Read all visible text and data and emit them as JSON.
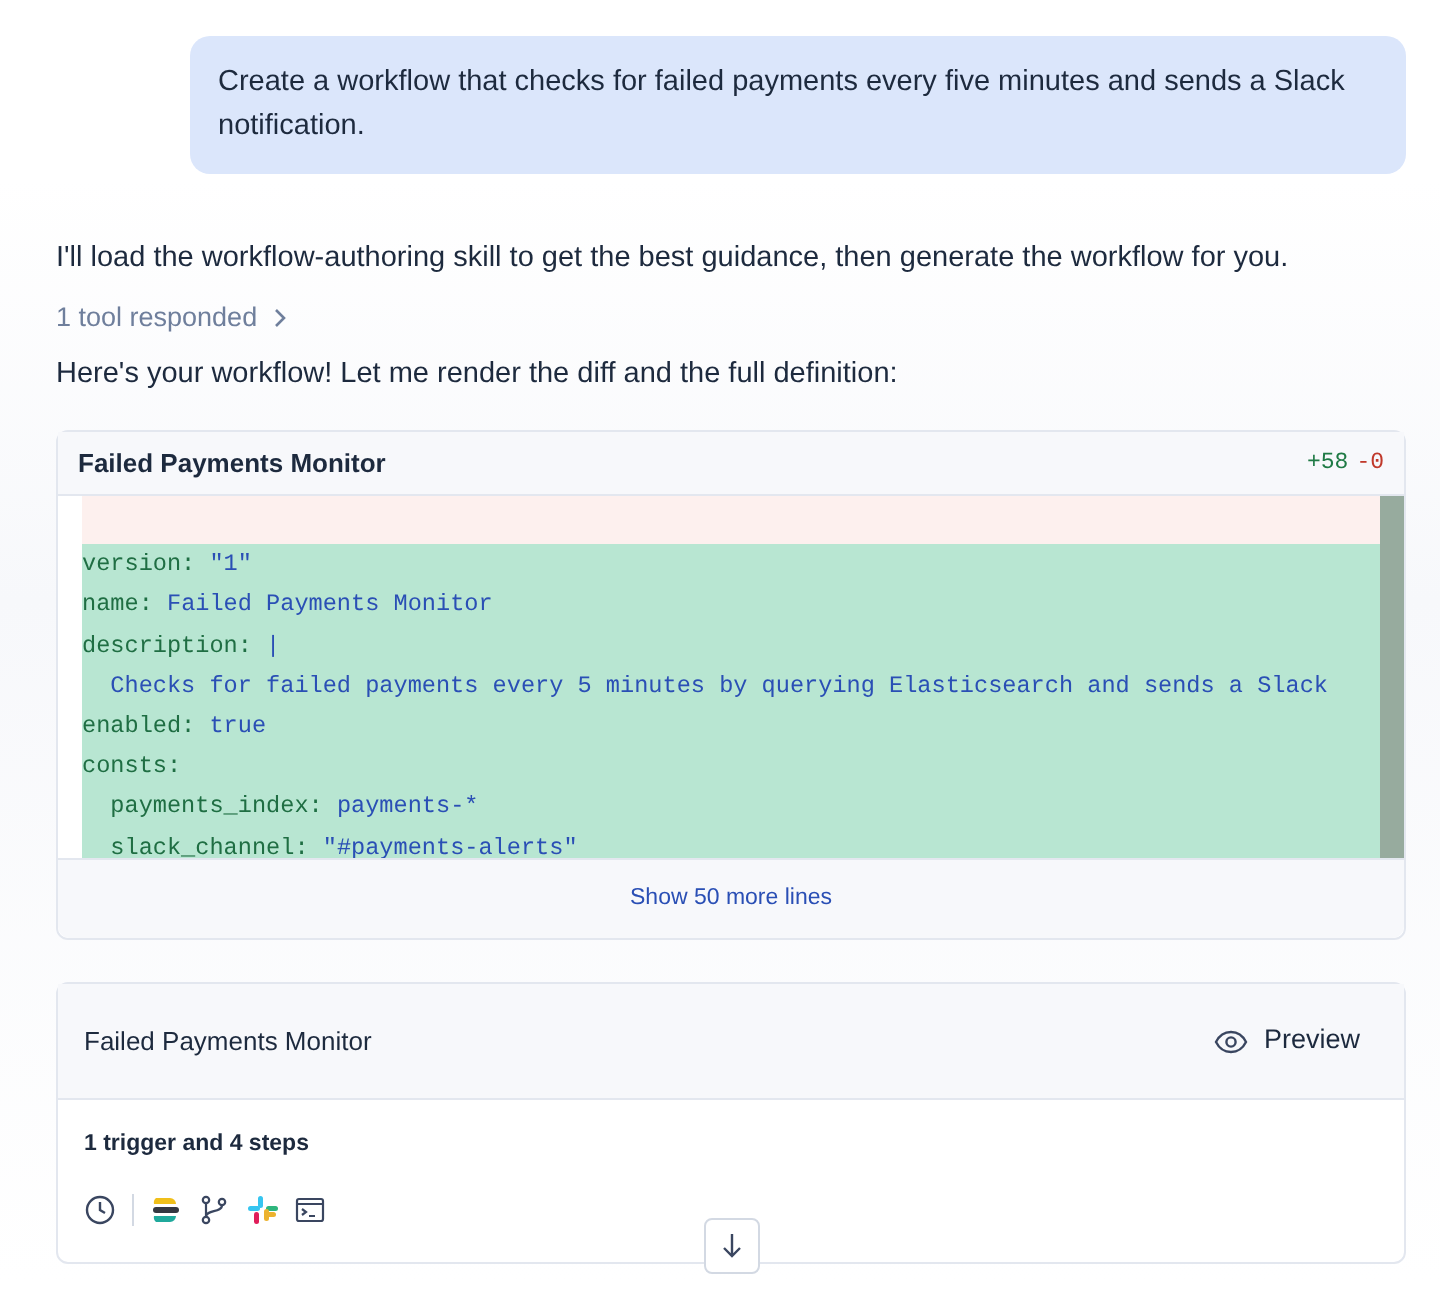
{
  "user_message": "Create a workflow that checks for failed payments every five minutes and sends a Slack notification.",
  "assistant": {
    "intro": "I'll load the workflow-authoring skill to get the best guidance, then generate the workflow for you.",
    "tool_toggle": "1 tool responded",
    "after": "Here's your workflow! Let me render the diff and the full definition:"
  },
  "diff": {
    "title": "Failed Payments Monitor",
    "added": "+58",
    "removed": "-0",
    "lines": [
      {
        "kind": "removed"
      },
      {
        "kind": "added",
        "key": "version:",
        "value": "\"1\""
      },
      {
        "kind": "added",
        "key": "name:",
        "value": "Failed Payments Monitor"
      },
      {
        "kind": "added",
        "key": "description:",
        "value": "|"
      },
      {
        "kind": "added",
        "value": "  Checks for failed payments every 5 minutes by querying Elasticsearch and sends a Slack"
      },
      {
        "kind": "added",
        "key": "enabled:",
        "value": "true"
      },
      {
        "kind": "added",
        "key": "consts:"
      },
      {
        "kind": "added",
        "key": "  payments_index:",
        "value": "payments-*"
      },
      {
        "kind": "added",
        "key": "  slack_channel:",
        "value": "\"#payments-alerts\""
      }
    ],
    "more": "Show 50 more lines"
  },
  "workflow": {
    "title": "Failed Payments Monitor",
    "preview": "Preview",
    "summary": "1 trigger and 4 steps",
    "steps": [
      {
        "kind": "schedule"
      },
      {
        "kind": "elasticsearch"
      },
      {
        "kind": "branch"
      },
      {
        "kind": "slack"
      },
      {
        "kind": "console"
      }
    ]
  }
}
